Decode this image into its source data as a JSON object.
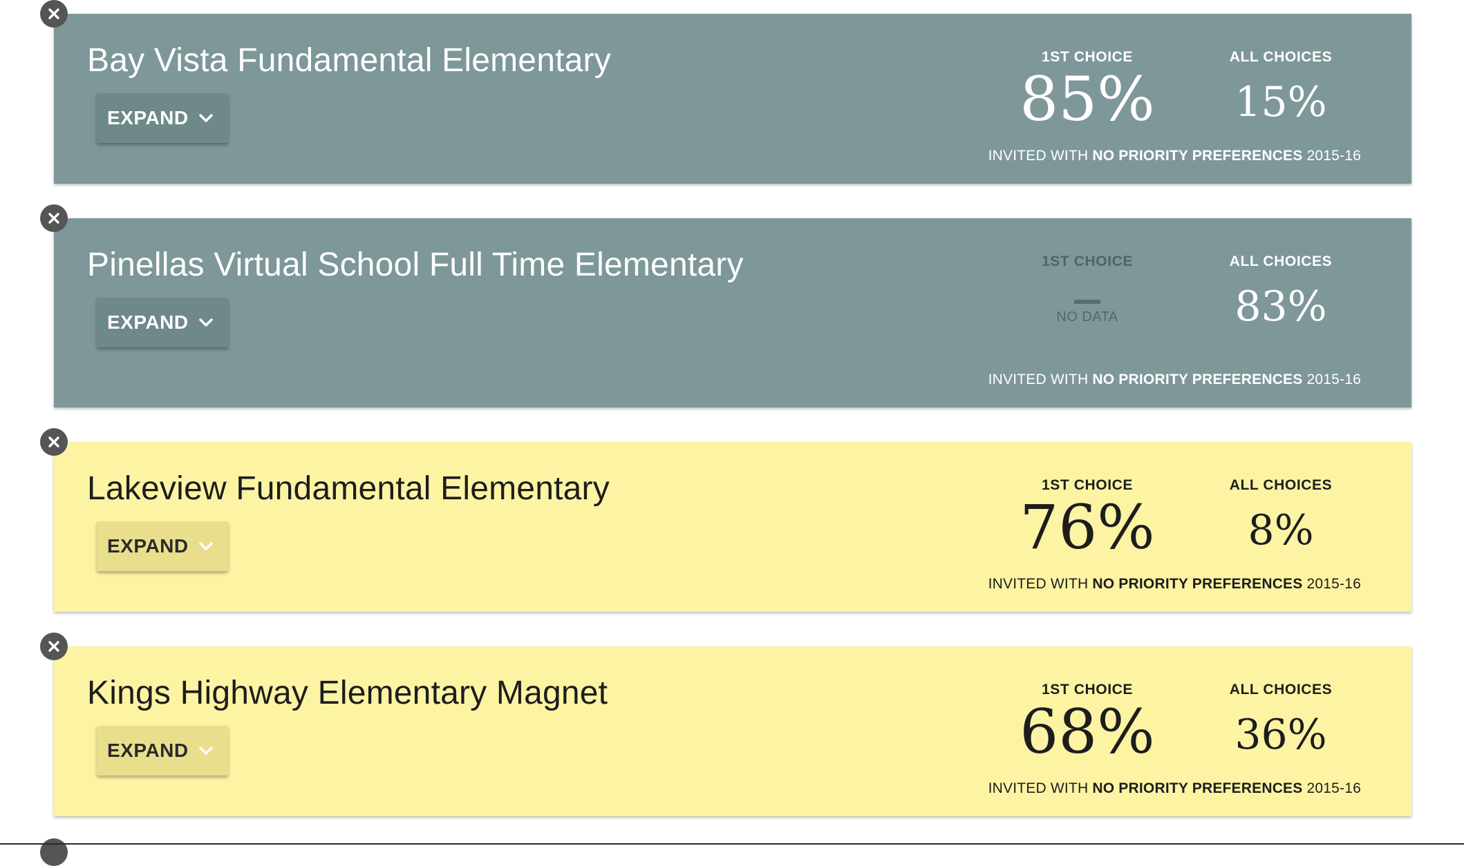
{
  "cards": [
    {
      "school_name": "Bay Vista Fundamental Elementary",
      "theme": "gray",
      "expand_label": "EXPAND",
      "first_choice_label": "1ST CHOICE",
      "first_choice_value": "85%",
      "all_choices_label": "ALL CHOICES",
      "all_choices_value": "15%",
      "footnote_prefix": "INVITED WITH ",
      "footnote_bold": "NO PRIORITY PREFERENCES",
      "footnote_suffix": " 2015-16"
    },
    {
      "school_name": "Pinellas Virtual School Full Time Elementary",
      "theme": "gray",
      "expand_label": "EXPAND",
      "first_choice_label": "1ST CHOICE",
      "first_choice_no_data": "NO DATA",
      "all_choices_label": "ALL CHOICES",
      "all_choices_value": "83%",
      "footnote_prefix": "INVITED WITH ",
      "footnote_bold": "NO PRIORITY PREFERENCES",
      "footnote_suffix": " 2015-16"
    },
    {
      "school_name": "Lakeview Fundamental Elementary",
      "theme": "yellow",
      "expand_label": "EXPAND",
      "first_choice_label": "1ST CHOICE",
      "first_choice_value": "76%",
      "all_choices_label": "ALL CHOICES",
      "all_choices_value": "8%",
      "footnote_prefix": "INVITED WITH ",
      "footnote_bold": "NO PRIORITY PREFERENCES",
      "footnote_suffix": " 2015-16"
    },
    {
      "school_name": "Kings Highway Elementary Magnet",
      "theme": "yellow",
      "expand_label": "EXPAND",
      "first_choice_label": "1ST CHOICE",
      "first_choice_value": "68%",
      "all_choices_label": "ALL CHOICES",
      "all_choices_value": "36%",
      "footnote_prefix": "INVITED WITH ",
      "footnote_bold": "NO PRIORITY PREFERENCES",
      "footnote_suffix": " 2015-16"
    }
  ],
  "colors": {
    "gray_card": "#7e9799",
    "yellow_card": "#fcf4a3",
    "close_button": "#555555"
  },
  "icons": {
    "close": "close-icon",
    "expand": "chevron-down-icon"
  }
}
